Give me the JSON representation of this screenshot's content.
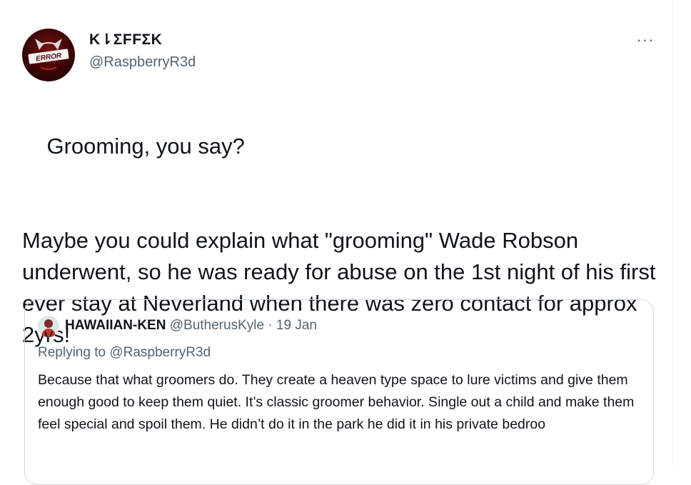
{
  "author": {
    "display_name": "K⇂ΣFFΣK",
    "handle": "@RaspberryR3d",
    "avatar_badge_text": "ERROR"
  },
  "menu": {
    "more_label": "···"
  },
  "tweet": {
    "line1": "Grooming, you say?",
    "line2": "Maybe you could explain what \"grooming\" Wade Robson underwent, so he was ready for abuse on the 1st night of his first ever stay at Neverland when there was zero contact for approx 2yrs!"
  },
  "quoted": {
    "name": "HAWAIIAN-KEN",
    "handle": "@ButherusKyle",
    "separator": "·",
    "date": "19 Jan",
    "replying_to": "Replying to @RaspberryR3d",
    "body": "Because that what groomers do. They create a heaven type space to lure victims and give them enough good to keep them quiet. It’s classic groomer behavior. Single out a child and make them feel special and spoil them. He didn’t do it in the park he did it in his private bedroo"
  }
}
